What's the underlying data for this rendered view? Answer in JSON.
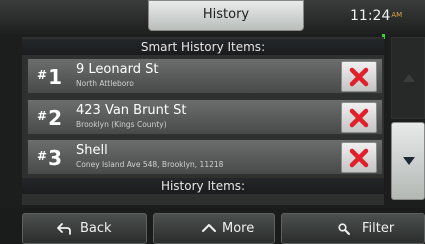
{
  "header": {
    "title": "History",
    "time": "11:24",
    "ampm": "AM"
  },
  "sections": {
    "smart": "Smart History Items:",
    "history": "History Items:"
  },
  "items": [
    {
      "rank": "1",
      "street": "9 Leonard St",
      "city": "North Attleboro"
    },
    {
      "rank": "2",
      "street": "423 Van Brunt St",
      "city": "Brooklyn (Kings County)"
    },
    {
      "rank": "3",
      "street": "Shell",
      "city": "Coney Island Ave 548, Brooklyn, 11218"
    }
  ],
  "footer": {
    "back": "Back",
    "more": "More",
    "filter": "Filter"
  },
  "colors": {
    "delete_x": "#e0202a",
    "accent_green": "#3fce3f"
  }
}
